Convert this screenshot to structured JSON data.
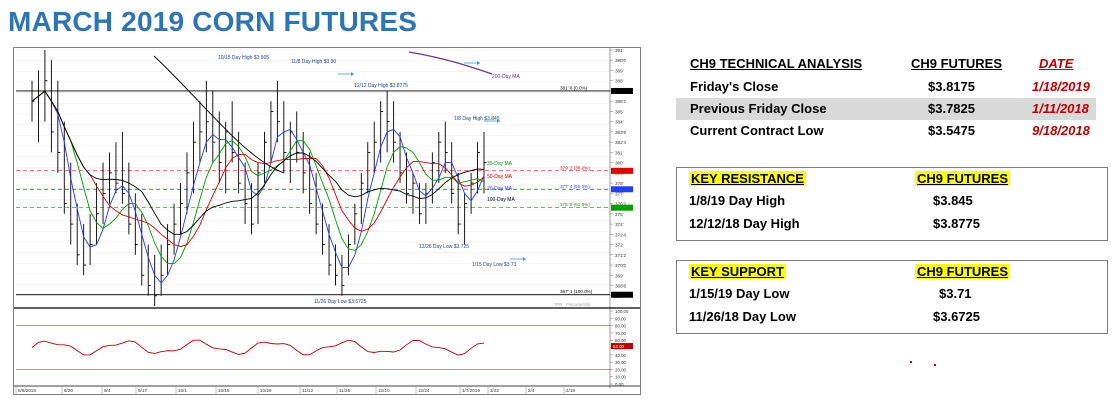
{
  "title": "MARCH 2019 CORN FUTURES",
  "chart_data": {
    "type": "candlestick",
    "price_axis": {
      "min": 366.0,
      "max": 391.0,
      "ticks": [
        391,
        390,
        389,
        388,
        387,
        386,
        385,
        384,
        383,
        382,
        381,
        380,
        379,
        378,
        377,
        376,
        375,
        374,
        373,
        372,
        371,
        370,
        369,
        368,
        367
      ],
      "tick_labels": [
        "391'",
        "390'0",
        "389'",
        "388'",
        "387'",
        "386'2",
        "385'",
        "384'",
        "383'6",
        "382'4",
        "381'",
        "380'",
        "379'",
        "378'",
        "377'",
        "376'2",
        "375'",
        "374'",
        "372'4",
        "372'",
        "371'2",
        "370'0",
        "369'",
        "368'6",
        "367'"
      ]
    },
    "x_axis_labels": [
      "8/6/2018",
      "8/20",
      "9/4",
      "9/17",
      "10/1",
      "10/15",
      "10/29",
      "11/12",
      "11/26",
      "12/10",
      "12/24",
      "1/7/2019",
      "1/22",
      "2/4",
      "2/19"
    ],
    "price_bars": [
      [
        388,
        384,
        386
      ],
      [
        389,
        382,
        387
      ],
      [
        391,
        384,
        388
      ],
      [
        390,
        381,
        383
      ],
      [
        388,
        379,
        381
      ],
      [
        384,
        375,
        376
      ],
      [
        380,
        372,
        374
      ],
      [
        376,
        370,
        371
      ],
      [
        374,
        369,
        370
      ],
      [
        375,
        370,
        372
      ],
      [
        378,
        372,
        375
      ],
      [
        380,
        374,
        377
      ],
      [
        381,
        376,
        379
      ],
      [
        382,
        377,
        378
      ],
      [
        383,
        376,
        377
      ],
      [
        380,
        373,
        374
      ],
      [
        377,
        371,
        372
      ],
      [
        375,
        368,
        369
      ],
      [
        372,
        367,
        368
      ],
      [
        371,
        366,
        367
      ],
      [
        372,
        367,
        369
      ],
      [
        374,
        369,
        372
      ],
      [
        376,
        371,
        374
      ],
      [
        378,
        373,
        376
      ],
      [
        381,
        375,
        379
      ],
      [
        384,
        377,
        382
      ],
      [
        386,
        380,
        383
      ],
      [
        388,
        381,
        384
      ],
      [
        387,
        380,
        382
      ],
      [
        385,
        378,
        380
      ],
      [
        384,
        377,
        383
      ],
      [
        386,
        380,
        381
      ],
      [
        383,
        377,
        378
      ],
      [
        380,
        374,
        376
      ],
      [
        378,
        373,
        374
      ],
      [
        380,
        374,
        379
      ],
      [
        383,
        378,
        382
      ],
      [
        386,
        380,
        385
      ],
      [
        388,
        382,
        384
      ],
      [
        386,
        379,
        381
      ],
      [
        384,
        378,
        383
      ],
      [
        385,
        380,
        381
      ],
      [
        383,
        377,
        379
      ],
      [
        381,
        375,
        376
      ],
      [
        379,
        373,
        374
      ],
      [
        376,
        371,
        372
      ],
      [
        374,
        369,
        370
      ],
      [
        372,
        368,
        369
      ],
      [
        371,
        367,
        368
      ],
      [
        373,
        369,
        372
      ],
      [
        376,
        372,
        375
      ],
      [
        379,
        374,
        378
      ],
      [
        382,
        377,
        381
      ],
      [
        384,
        379,
        382
      ],
      [
        386,
        380,
        385
      ],
      [
        387,
        381,
        384
      ],
      [
        386,
        380,
        382
      ],
      [
        383,
        378,
        379
      ],
      [
        381,
        376,
        377
      ],
      [
        379,
        375,
        378
      ],
      [
        378,
        374,
        375
      ],
      [
        378,
        374,
        377
      ],
      [
        381,
        376,
        380
      ],
      [
        383,
        378,
        382
      ],
      [
        384,
        379,
        381
      ],
      [
        382,
        376,
        377
      ],
      [
        379,
        373,
        374
      ],
      [
        377,
        372,
        376
      ],
      [
        379,
        375,
        378
      ],
      [
        382,
        377,
        381
      ],
      [
        383,
        377,
        380
      ]
    ],
    "moving_averages": [
      {
        "name": "200-Day MA",
        "color": "#7030a0"
      },
      {
        "name": "35-Day MA",
        "color": "#00a000"
      },
      {
        "name": "50-Day MA",
        "color": "#e00000"
      },
      {
        "name": "20-Day MA",
        "color": "#1f3fff"
      },
      {
        "name": "100-Day MA",
        "color": "#000000"
      }
    ],
    "reference_lines": [
      {
        "label": "381' 6 (0.0%)",
        "value": 387.0,
        "color": "#000000",
        "style": "solid"
      },
      {
        "label": "379' 2 (38.2%)",
        "value": 379.2,
        "color": "#e00000",
        "style": "dashed"
      },
      {
        "label": "377' 4 (50.0%)",
        "value": 377.4,
        "color": "#1f3fff",
        "style": "dashed"
      },
      {
        "label": "375' 6 (61.8%)",
        "value": 375.6,
        "color": "#00a000",
        "style": "dashed"
      },
      {
        "label": "367' 1 (100.0%)",
        "value": 367.1,
        "color": "#000000",
        "style": "solid"
      }
    ],
    "annotations": [
      "10/15 Day High $3.905",
      "11/8 Day High $3.90",
      "12/12 Day High $3.8775",
      "1/8 Day High $3.845",
      "12/26 Day Low $3.725",
      "1/15 Day Low $3.71",
      "11/26 Day Low $3.6725",
      "200-Day MA",
      "35-Day MA",
      "50-Day MA",
      "20-Day MA",
      "100-Day MA",
      "TPR · Pinnacle/Info"
    ],
    "oscillator": {
      "axis_labels": [
        "100.00",
        "90.00",
        "80.00",
        "70.00",
        "60.00",
        "50.00",
        "40.00",
        "30.00",
        "20.00",
        "10.00",
        "0.00"
      ],
      "upper_level": 80,
      "lower_level": 20,
      "last_value": "52.00"
    }
  },
  "tech_table": {
    "headers": [
      "CH9 TECHNICAL ANALYSIS",
      "CH9 FUTURES",
      "DATE"
    ],
    "rows": [
      {
        "label": "Friday's Close",
        "price": "$3.8175",
        "date": "1/18/2019"
      },
      {
        "label": "Previous Friday Close",
        "price": "$3.7825",
        "date": "1/11/2018"
      },
      {
        "label": "Current Contract Low",
        "price": "$3.5475",
        "date": "9/18/2018"
      }
    ]
  },
  "resistance": {
    "headers": [
      "KEY RESISTANCE",
      "CH9 FUTURES"
    ],
    "rows": [
      {
        "label": "1/8/19 Day High",
        "price": "$3.845"
      },
      {
        "label": "12/12/18 Day High",
        "price": "$3.8775"
      }
    ]
  },
  "support": {
    "headers": [
      "KEY SUPPORT",
      "CH9 FUTURES"
    ],
    "rows": [
      {
        "label": "1/15/19 Day Low",
        "price": "$3.71"
      },
      {
        "label": "11/26/18 Day Low",
        "price": "$3.6725"
      }
    ]
  }
}
